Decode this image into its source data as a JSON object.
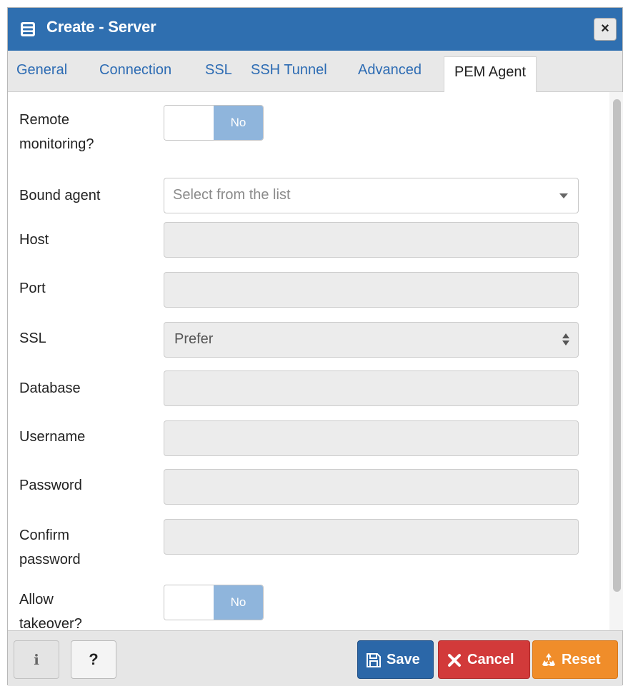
{
  "window": {
    "title": "Create - Server",
    "close_label": "×"
  },
  "tabs": [
    {
      "label": "General"
    },
    {
      "label": "Connection"
    },
    {
      "label": "SSL"
    },
    {
      "label": "SSH Tunnel"
    },
    {
      "label": "Advanced"
    },
    {
      "label": "PEM Agent",
      "active": true
    }
  ],
  "form": {
    "remote_monitoring": {
      "label_line1": "Remote",
      "label_line2": "monitoring?",
      "value": "No"
    },
    "bound_agent": {
      "label": "Bound agent",
      "placeholder": "Select from the list"
    },
    "host": {
      "label": "Host",
      "value": ""
    },
    "port": {
      "label": "Port",
      "value": ""
    },
    "ssl": {
      "label": "SSL",
      "value": "Prefer"
    },
    "database": {
      "label": "Database",
      "value": ""
    },
    "username": {
      "label": "Username",
      "value": ""
    },
    "password": {
      "label": "Password",
      "value": ""
    },
    "confirm_password": {
      "label_line1": "Confirm",
      "label_line2": "password",
      "value": ""
    },
    "allow_takeover": {
      "label_line1": "Allow",
      "label_line2": "takeover?",
      "value": "No"
    }
  },
  "footer": {
    "info_label": "i",
    "help_label": "?",
    "save_label": "Save",
    "cancel_label": "Cancel",
    "reset_label": "Reset"
  },
  "colors": {
    "titlebar": "#2f6fb0",
    "tab_link": "#2c6bb3",
    "toggle_off": "#8fb5dc",
    "save": "#2b67a8",
    "cancel": "#d23a3a",
    "reset": "#f08d2a"
  }
}
